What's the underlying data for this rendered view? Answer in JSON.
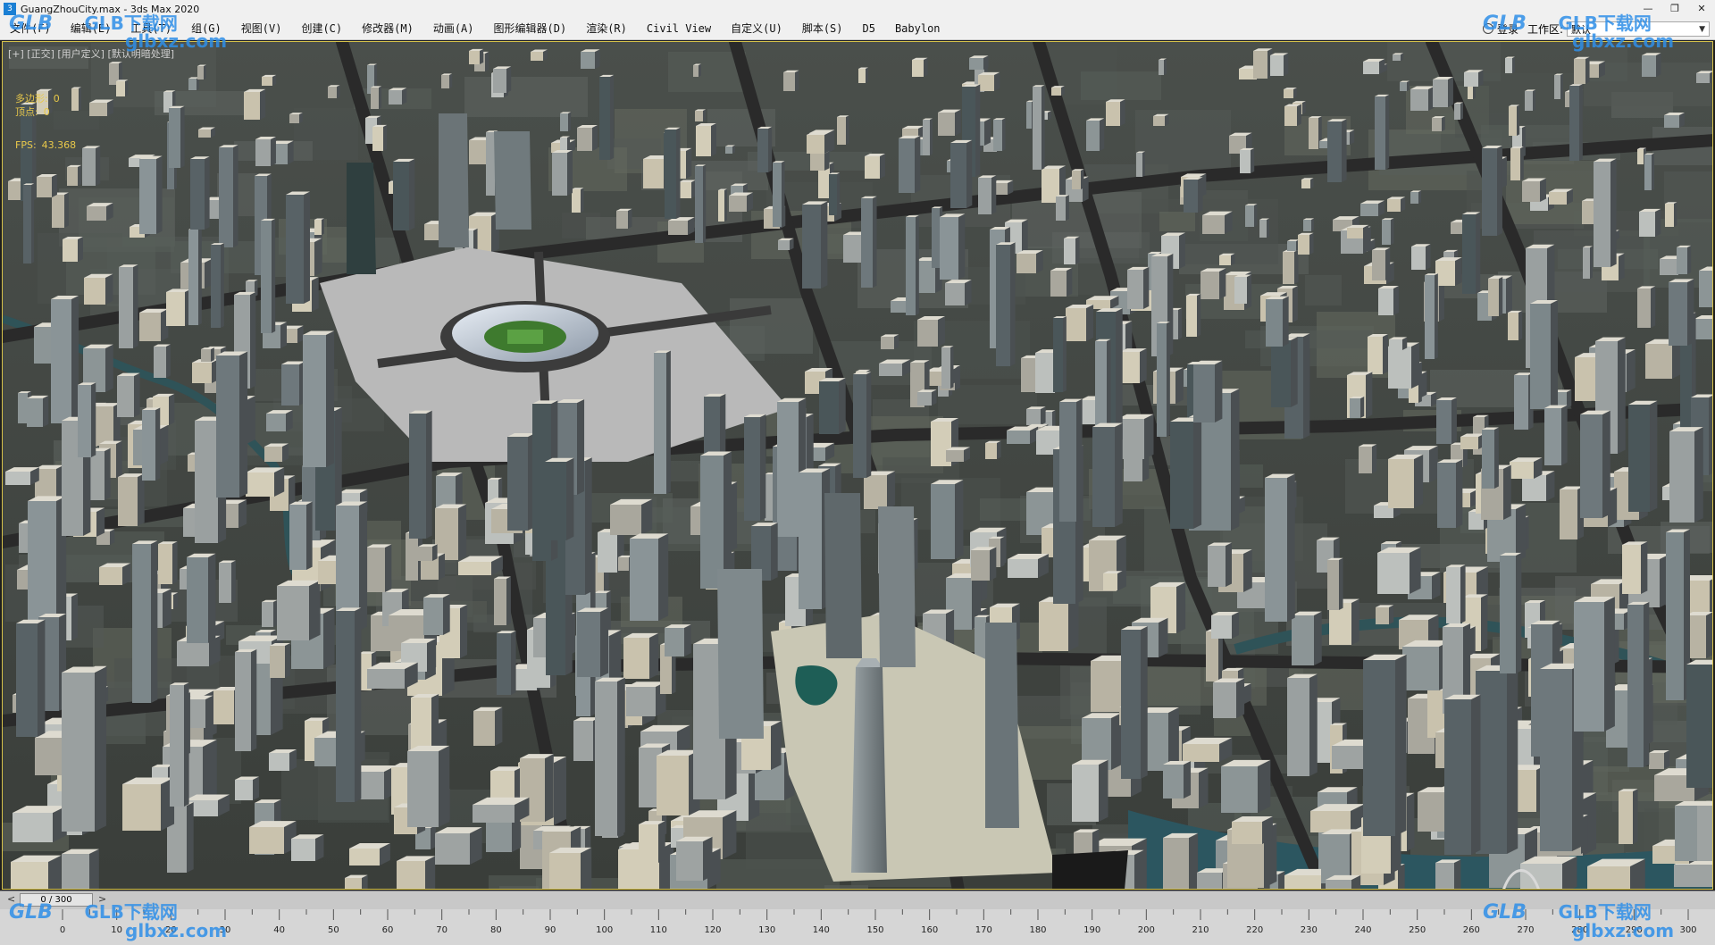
{
  "window": {
    "title": "GuangZhouCity.max - 3ds Max 2020",
    "app_icon": "3",
    "minimize": "—",
    "maximize": "❐",
    "close": "✕"
  },
  "menu": [
    "文件(F)",
    "编辑(E)",
    "工具(T)",
    "组(G)",
    "视图(V)",
    "创建(C)",
    "修改器(M)",
    "动画(A)",
    "图形编辑器(D)",
    "渲染(R)",
    "Civil View",
    "自定义(U)",
    "脚本(S)",
    "D5",
    "Babylon"
  ],
  "login_label": "登录",
  "workspace": {
    "label": "工作区:",
    "value": "默认"
  },
  "viewport": {
    "label": "[+] [正交] [用户定义] [默认明暗处理]",
    "stats": {
      "poly_label": "多边形:",
      "poly_value": "0",
      "vert_label": "顶点:",
      "vert_value": "0",
      "fps_label": "FPS:",
      "fps_value": "43.368"
    }
  },
  "timeslider": {
    "frame_text": "0 / 300",
    "prev": "<",
    "next": ">"
  },
  "trackbar": {
    "ticks": [
      "0",
      "10",
      "20",
      "30",
      "40",
      "50",
      "60",
      "70",
      "80",
      "90",
      "100",
      "110",
      "120",
      "130",
      "140",
      "150",
      "160",
      "170",
      "180",
      "190",
      "200",
      "210",
      "220",
      "230",
      "240",
      "250",
      "260",
      "270",
      "280",
      "290",
      "300"
    ]
  },
  "watermark": {
    "logo": "GLB",
    "site": "GLB下载网",
    "url": "glbxz.com"
  }
}
